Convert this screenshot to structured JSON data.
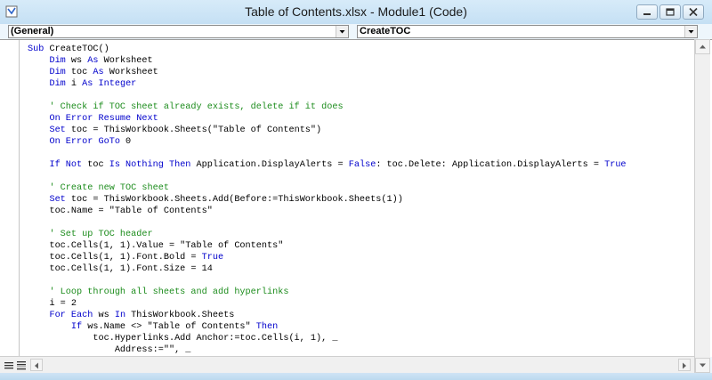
{
  "window": {
    "title": "Table of Contents.xlsx - Module1 (Code)"
  },
  "object_combo": {
    "value": "(General)"
  },
  "procedure_combo": {
    "value": "CreateTOC"
  },
  "icons": {
    "app": "vba-project-icon",
    "minimize": "minimize-icon",
    "maximize": "restore-icon",
    "close": "close-icon",
    "dropdown": "chevron-down-icon",
    "procedure_view": "procedure-view-icon",
    "full_module_view": "full-module-view-icon"
  },
  "code_lines": [
    [
      [
        "Sub ",
        "kw"
      ],
      [
        "CreateTOC()",
        ""
      ]
    ],
    [
      [
        "    Dim ",
        "kw"
      ],
      [
        "ws ",
        ""
      ],
      [
        "As ",
        "kw"
      ],
      [
        "Worksheet",
        ""
      ]
    ],
    [
      [
        "    Dim ",
        "kw"
      ],
      [
        "toc ",
        ""
      ],
      [
        "As ",
        "kw"
      ],
      [
        "Worksheet",
        ""
      ]
    ],
    [
      [
        "    Dim ",
        "kw"
      ],
      [
        "i ",
        ""
      ],
      [
        "As Integer",
        "kw"
      ]
    ],
    [
      [
        "",
        ""
      ]
    ],
    [
      [
        "    ' Check if TOC sheet already exists, delete if it does",
        "cm"
      ]
    ],
    [
      [
        "    On Error Resume Next",
        "kw"
      ]
    ],
    [
      [
        "    Set ",
        "kw"
      ],
      [
        "toc = ThisWorkbook.Sheets(\"Table of Contents\")",
        ""
      ]
    ],
    [
      [
        "    On Error GoTo ",
        "kw"
      ],
      [
        "0",
        ""
      ]
    ],
    [
      [
        "",
        ""
      ]
    ],
    [
      [
        "    If Not ",
        "kw"
      ],
      [
        "toc ",
        ""
      ],
      [
        "Is Nothing Then ",
        "kw"
      ],
      [
        "Application.DisplayAlerts = ",
        ""
      ],
      [
        "False",
        "kw"
      ],
      [
        ": toc.Delete: Application.DisplayAlerts = ",
        ""
      ],
      [
        "True",
        "kw"
      ]
    ],
    [
      [
        "",
        ""
      ]
    ],
    [
      [
        "    ' Create new TOC sheet",
        "cm"
      ]
    ],
    [
      [
        "    Set ",
        "kw"
      ],
      [
        "toc = ThisWorkbook.Sheets.Add(Before:=ThisWorkbook.Sheets(1))",
        ""
      ]
    ],
    [
      [
        "    toc.Name = \"Table of Contents\"",
        ""
      ]
    ],
    [
      [
        "",
        ""
      ]
    ],
    [
      [
        "    ' Set up TOC header",
        "cm"
      ]
    ],
    [
      [
        "    toc.Cells(1, 1).Value = \"Table of Contents\"",
        ""
      ]
    ],
    [
      [
        "    toc.Cells(1, 1).Font.Bold = ",
        ""
      ],
      [
        "True",
        "kw"
      ]
    ],
    [
      [
        "    toc.Cells(1, 1).Font.Size = 14",
        ""
      ]
    ],
    [
      [
        "",
        ""
      ]
    ],
    [
      [
        "    ' Loop through all sheets and add hyperlinks",
        "cm"
      ]
    ],
    [
      [
        "    i = 2",
        ""
      ]
    ],
    [
      [
        "    For Each ",
        "kw"
      ],
      [
        "ws ",
        ""
      ],
      [
        "In ",
        "kw"
      ],
      [
        "ThisWorkbook.Sheets",
        ""
      ]
    ],
    [
      [
        "        If ",
        "kw"
      ],
      [
        "ws.Name <> \"Table of Contents\" ",
        ""
      ],
      [
        "Then",
        "kw"
      ]
    ],
    [
      [
        "            toc.Hyperlinks.Add Anchor:=toc.Cells(i, 1), _",
        ""
      ]
    ],
    [
      [
        "                Address:=\"\", _",
        ""
      ]
    ]
  ]
}
